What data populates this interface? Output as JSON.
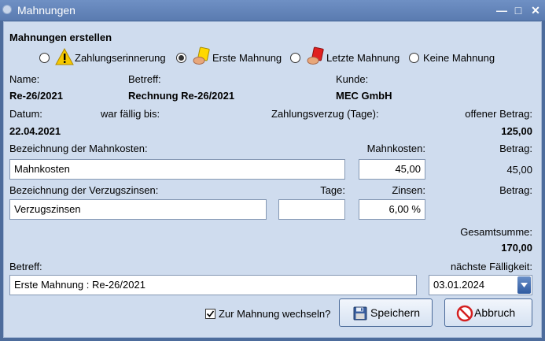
{
  "window": {
    "title": "Mahnungen"
  },
  "heading": "Mahnungen erstellen",
  "options": [
    {
      "label": "Zahlungserinnerung",
      "selected": false,
      "icon": "warning-icon"
    },
    {
      "label": "Erste Mahnung",
      "selected": true,
      "icon": "yellow-card-icon"
    },
    {
      "label": "Letzte Mahnung",
      "selected": false,
      "icon": "red-card-icon"
    },
    {
      "label": "Keine Mahnung",
      "selected": false,
      "icon": ""
    }
  ],
  "info": {
    "name_label": "Name:",
    "name_value": "Re-26/2021",
    "subject_label": "Betreff:",
    "subject_value": "Rechnung Re-26/2021",
    "customer_label": "Kunde:",
    "customer_value": "MEC GmbH",
    "date_label": "Datum:",
    "date_value": "22.04.2021",
    "due_label": "war fällig bis:",
    "overdue_label": "Zahlungsverzug (Tage):",
    "open_label": "offener Betrag:",
    "open_value": "125,00"
  },
  "fees": {
    "desc_label": "Bezeichnung der Mahnkosten:",
    "desc_value": "Mahnkosten",
    "cost_label": "Mahnkosten:",
    "cost_value": "45,00",
    "amount_label": "Betrag:",
    "amount_value": "45,00"
  },
  "interest": {
    "desc_label": "Bezeichnung der Verzugszinsen:",
    "desc_value": "Verzugszinsen",
    "days_label": "Tage:",
    "days_value": "",
    "rate_label": "Zinsen:",
    "rate_value": "6,00 %",
    "amount_label": "Betrag:"
  },
  "total": {
    "label": "Gesamtsumme:",
    "value": "170,00"
  },
  "footer": {
    "subject_label": "Betreff:",
    "subject_value": "Erste Mahnung : Re-26/2021",
    "next_due_label": "nächste Fälligkeit:",
    "next_due_value": "03.01.2024",
    "switch_label": "Zur Mahnung wechseln?",
    "switch_checked": true,
    "save_label": "Speichern",
    "cancel_label": "Abbruch"
  }
}
